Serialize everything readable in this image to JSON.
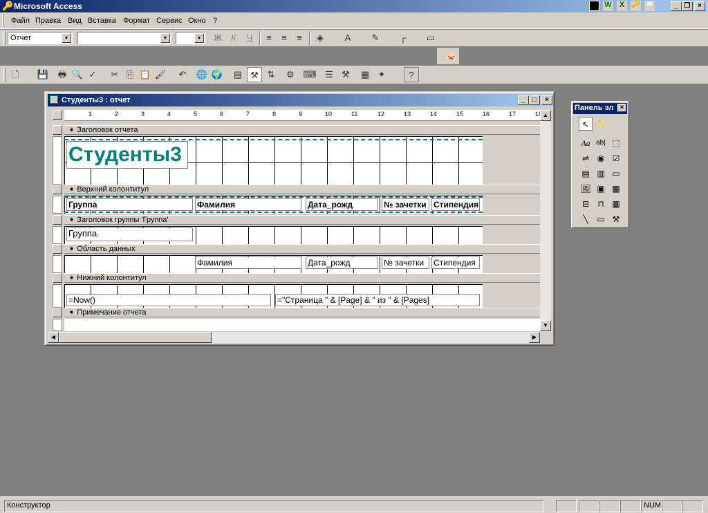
{
  "app": {
    "title": "Microsoft Access"
  },
  "menu": [
    "Файл",
    "Правка",
    "Вид",
    "Вставка",
    "Формат",
    "Сервис",
    "Окно",
    "?"
  ],
  "formatting_toolbar": {
    "object_combo": "Отчет",
    "font_combo": "",
    "size_combo": "",
    "bold": "Ж",
    "italic": "К",
    "underline": "Ч"
  },
  "report_window": {
    "title": "Студенты3 : отчет",
    "ruler_numbers": [
      "1",
      "2",
      "3",
      "4",
      "5",
      "6",
      "7",
      "8",
      "9",
      "10",
      "11",
      "12",
      "13",
      "14",
      "15",
      "16",
      "17",
      "18"
    ],
    "sections": {
      "report_header": "Заголовок отчета",
      "page_header": "Верхний колонтитул",
      "group_header": "Заголовок группы 'Группа'",
      "detail": "Область данных",
      "page_footer": "Нижний колонтитул",
      "report_footer": "Примечание отчета"
    },
    "report_title": "Студенты3",
    "page_header_labels": [
      "Группа",
      "Фамилия",
      "Дата_рожд",
      "№ зачетки",
      "Стипендия"
    ],
    "group_field": "Группа",
    "detail_fields": [
      "Фамилия",
      "Дата_рожд",
      "№ зачетки",
      "Стипендия"
    ],
    "footer_now": "=Now()",
    "footer_page": "=\"Страница \" & [Page] & \" из \" & [Pages]",
    "title_color": "#008080"
  },
  "toolbox": {
    "title": "Панель эл",
    "label_tool": "Aa",
    "textbox_tool": "ab|"
  },
  "status": {
    "mode": "Конструктор",
    "num": "NUM"
  }
}
